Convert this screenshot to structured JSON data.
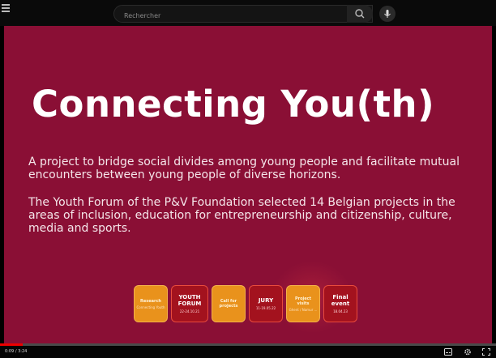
{
  "topbar": {
    "search_placeholder": "Rechercher",
    "icons": [
      "menu-icon",
      "search-icon",
      "microphone-icon"
    ]
  },
  "slide": {
    "title": "Connecting You(th)",
    "paragraph1": "A project to bridge social divides among young people and facilitate mutual encounters between young people of diverse horizons.",
    "paragraph2": "The Youth Forum of the P&V Foundation selected 14 Belgian projects in the areas of inclusion, education for entrepreneurship and citizenship, culture, media and sports.",
    "colors": {
      "background": "#8a0f35",
      "orange": "#e9921c",
      "dark_red": "#a3121e"
    },
    "timeline": [
      {
        "title": "Research",
        "sub": "Connecting Youth",
        "date": "",
        "style": "orange"
      },
      {
        "title": "YOUTH FORUM",
        "sub": "",
        "date": "22-24.10.21",
        "style": "dark"
      },
      {
        "title": "Call for projects",
        "sub": "",
        "date": "",
        "style": "orange"
      },
      {
        "title": "JURY",
        "sub": "",
        "date": "11-19.05.22",
        "style": "dark"
      },
      {
        "title": "Project visits",
        "sub": "Ghent / Namur ...",
        "date": "",
        "style": "orange"
      },
      {
        "title": "Final event",
        "sub": "",
        "date": "18.04.23",
        "style": "dark"
      }
    ]
  },
  "player": {
    "time": "0:09 / 3:24",
    "progress_fraction": 0.045,
    "icons": [
      "subtitles-icon",
      "settings-icon",
      "fullscreen-icon"
    ]
  }
}
